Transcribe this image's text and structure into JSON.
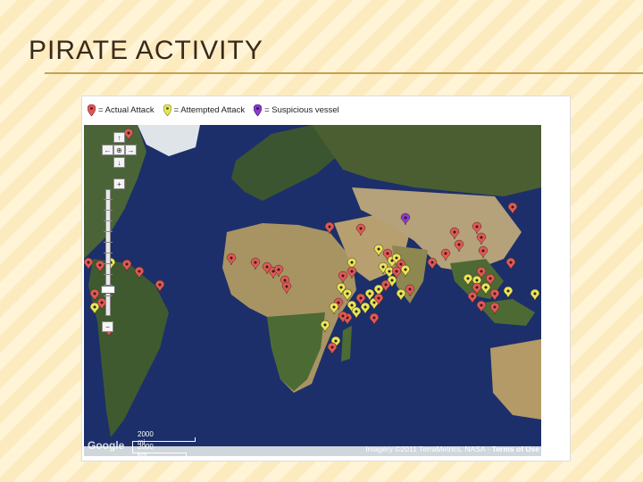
{
  "slide": {
    "title": "PIRATE ACTIVITY"
  },
  "legend": {
    "items": [
      {
        "label": "= Actual Attack",
        "color": "#e05858"
      },
      {
        "label": "= Attempted Attack",
        "color": "#e6e65a"
      },
      {
        "label": "= Suspicious vessel",
        "color": "#8a3ad0"
      }
    ]
  },
  "map": {
    "scale_mi": "2000 mi",
    "scale_km": "2000 km",
    "logo": "Google",
    "attribution_imagery": "Imagery ©2011 TerraMetrics, NASA",
    "attribution_terms": "Terms of Use",
    "colors": {
      "ocean": "#1c2f6a",
      "land_green": "#3f5a2e",
      "desert": "#b8a47a",
      "ice": "#e8ecef"
    }
  },
  "nav": {
    "up": "↑",
    "left": "←",
    "center": "⊕",
    "right": "→",
    "down": "↓",
    "zoom_in": "+",
    "zoom_out": "−"
  }
}
